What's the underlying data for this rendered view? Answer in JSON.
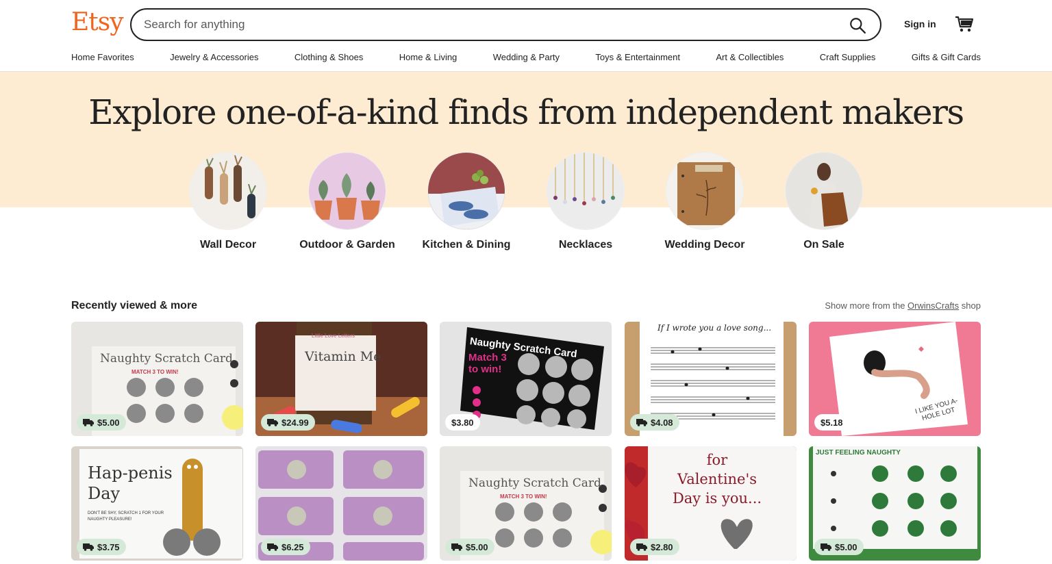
{
  "header": {
    "logo": "Etsy",
    "search_placeholder": "Search for anything",
    "sign_in": "Sign in"
  },
  "nav": [
    "Home Favorites",
    "Jewelry & Accessories",
    "Clothing & Shoes",
    "Home & Living",
    "Wedding & Party",
    "Toys & Entertainment",
    "Art & Collectibles",
    "Craft Supplies",
    "Gifts & Gift Cards"
  ],
  "hero": {
    "title": "Explore one-of-a-kind finds from independent makers",
    "categories": [
      {
        "label": "Wall Decor"
      },
      {
        "label": "Outdoor & Garden"
      },
      {
        "label": "Kitchen & Dining"
      },
      {
        "label": "Necklaces"
      },
      {
        "label": "Wedding Decor"
      },
      {
        "label": "On Sale"
      }
    ]
  },
  "recent": {
    "title": "Recently viewed & more",
    "more_prefix": "Show more from the",
    "shop_name": "OrwinsCrafts",
    "more_suffix": "shop",
    "items": [
      {
        "price": "$5.00",
        "free_shipping": true,
        "card_title": "Naughty Scratch Card",
        "card_sub": "MATCH 3 TO WIN!"
      },
      {
        "price": "$24.99",
        "free_shipping": true,
        "card_title": "Vitamin Me",
        "card_sub": "Little Love Letters"
      },
      {
        "price": "$3.80",
        "free_shipping": false,
        "card_title": "Naughty Scratch Card",
        "card_sub": "Match 3 to win!"
      },
      {
        "price": "$4.08",
        "free_shipping": true,
        "card_title": "If I wrote you a love song...",
        "card_sub": ""
      },
      {
        "price": "$5.18",
        "free_shipping": false,
        "card_title": "I LIKE YOU A-HOLE LOT",
        "card_sub": ""
      },
      {
        "price": "$3.75",
        "free_shipping": true,
        "card_title": "Hap-penis Day",
        "card_sub": "DON'T BE SHY, SCRATCH 1 FOR YOUR NAUGHTY PLEASURE!"
      },
      {
        "price": "$6.25",
        "free_shipping": true,
        "card_title": "",
        "card_sub": ""
      },
      {
        "price": "$5.00",
        "free_shipping": true,
        "card_title": "Naughty Scratch Card",
        "card_sub": "MATCH 3 TO WIN!"
      },
      {
        "price": "$2.80",
        "free_shipping": true,
        "card_title": "for Valentine's Day is you...",
        "card_sub": ""
      },
      {
        "price": "$5.00",
        "free_shipping": true,
        "card_title": "JUST FEELING NAUGHTY",
        "card_sub": ""
      }
    ]
  },
  "colors": {
    "brand": "#F1641E",
    "hero_band": "#FDEBD2",
    "shipping_badge": "#D4E9D7"
  }
}
